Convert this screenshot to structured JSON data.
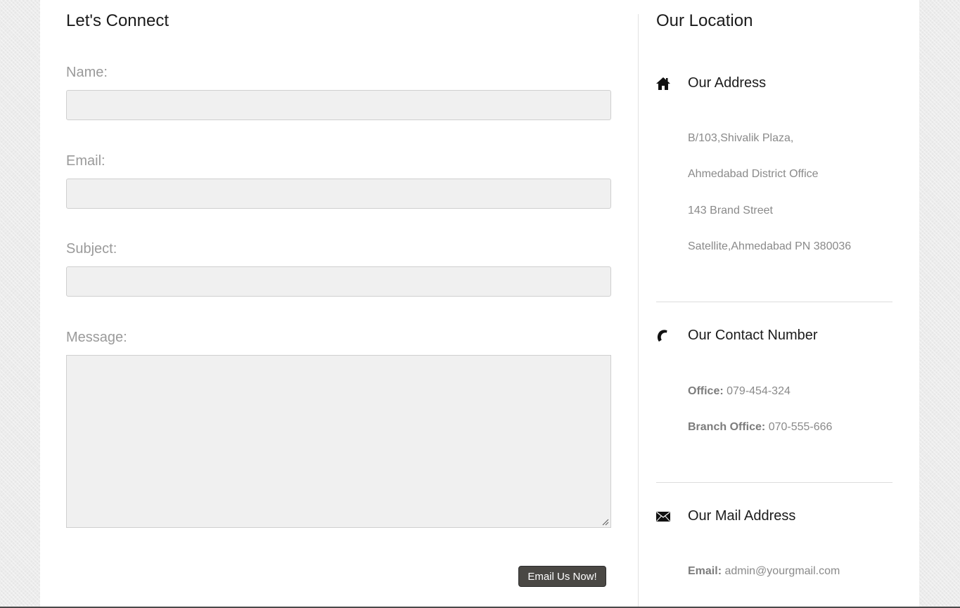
{
  "contact_form": {
    "title": "Let's Connect",
    "fields": {
      "name": {
        "label": "Name:",
        "value": ""
      },
      "email": {
        "label": "Email:",
        "value": ""
      },
      "subject": {
        "label": "Subject:",
        "value": ""
      },
      "message": {
        "label": "Message:",
        "value": ""
      }
    },
    "submit_label": "Email Us Now!"
  },
  "location": {
    "title": "Our Location",
    "address": {
      "icon": "home-icon",
      "heading": "Our Address",
      "lines": [
        "B/103,Shivalik Plaza,",
        "Ahmedabad District Office",
        "143 Brand Street",
        "Satellite,Ahmedabad PN 380036"
      ]
    },
    "contact": {
      "icon": "phone-icon",
      "heading": "Our Contact Number",
      "office_label": "Office:",
      "office_value": "079-454-324",
      "branch_label": "Branch Office:",
      "branch_value": "070-555-666"
    },
    "mail": {
      "icon": "envelope-icon",
      "heading": "Our Mail Address",
      "email_label": "Email:",
      "email_value": "admin@yourgmail.com"
    }
  },
  "colors": {
    "button_bg": "#4a4844",
    "input_bg": "#f0f0f0",
    "label_text": "#9a9a9a",
    "heading_text": "#1b1b1b"
  }
}
